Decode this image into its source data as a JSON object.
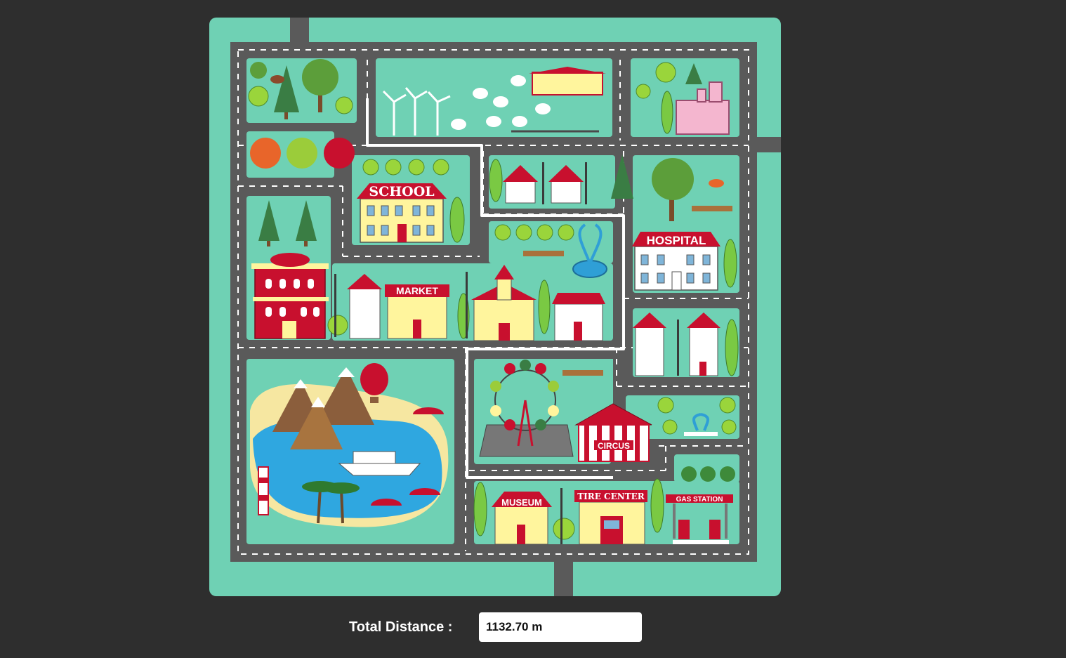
{
  "map": {
    "buildings": {
      "school": "SCHOOL",
      "hospital": "HOSPITAL",
      "market": "MARKET",
      "circus": "CIRCUS",
      "museum": "MUSEUM",
      "tire_center": "TIRE CENTER",
      "gas_station": "GAS STATION"
    },
    "colors": {
      "grass": "#6fd1b4",
      "road": "#5a5a5a",
      "route": "#ffffff",
      "brand_red": "#c8102e"
    }
  },
  "footer": {
    "distance_label": "Total Distance :",
    "distance_value": "1132.70 m"
  }
}
